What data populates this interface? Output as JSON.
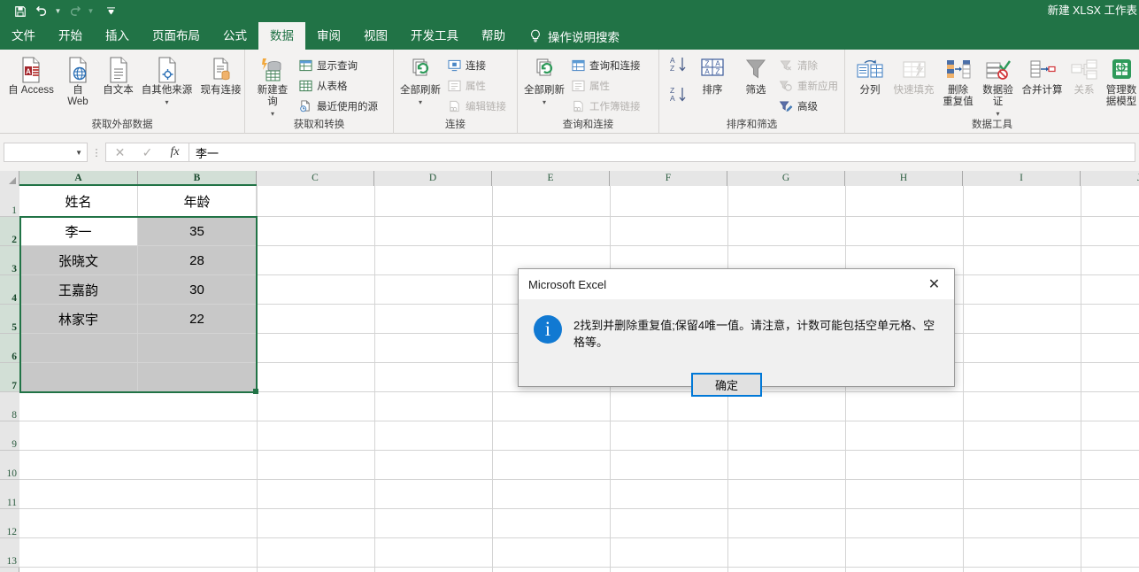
{
  "window": {
    "title": "新建 XLSX 工作表",
    "app": "Microsoft Excel"
  },
  "quick_access": {
    "save": "save-icon",
    "undo": "undo-icon",
    "redo": "redo-icon",
    "customize": "customize-qat-icon"
  },
  "tabs": [
    {
      "label": "文件",
      "active": false
    },
    {
      "label": "开始",
      "active": false
    },
    {
      "label": "插入",
      "active": false
    },
    {
      "label": "页面布局",
      "active": false
    },
    {
      "label": "公式",
      "active": false
    },
    {
      "label": "数据",
      "active": true
    },
    {
      "label": "审阅",
      "active": false
    },
    {
      "label": "视图",
      "active": false
    },
    {
      "label": "开发工具",
      "active": false
    },
    {
      "label": "帮助",
      "active": false
    }
  ],
  "tell_me": "操作说明搜索",
  "ribbon": {
    "groups": [
      {
        "name": "获取外部数据",
        "label": "获取外部数据",
        "buttons": [
          {
            "label": "自 Access",
            "icon": "access-db-icon",
            "disabled": false
          },
          {
            "label": "自\nWeb",
            "icon": "web-globe-icon",
            "disabled": false
          },
          {
            "label": "自文本",
            "icon": "text-file-icon",
            "disabled": false
          },
          {
            "label": "自其他来源",
            "icon": "other-sources-icon",
            "disabled": false,
            "dropdown": true
          },
          {
            "label": "现有连接",
            "icon": "existing-connection-icon",
            "disabled": false
          }
        ]
      },
      {
        "name": "获取和转换",
        "label": "获取和转换",
        "big": {
          "label": "新建查\n询",
          "icon": "new-query-icon",
          "dropdown": true
        },
        "small": [
          {
            "label": "显示查询",
            "icon": "show-queries-icon",
            "disabled": false
          },
          {
            "label": "从表格",
            "icon": "from-table-icon",
            "disabled": false
          },
          {
            "label": "最近使用的源",
            "icon": "recent-sources-icon",
            "disabled": false
          }
        ]
      },
      {
        "name": "连接",
        "label": "连接",
        "big": {
          "label": "全部刷新",
          "icon": "refresh-all-icon",
          "dropdown": true
        },
        "small": [
          {
            "label": "连接",
            "icon": "connections-icon",
            "disabled": false
          },
          {
            "label": "属性",
            "icon": "properties-icon",
            "disabled": true
          },
          {
            "label": "编辑链接",
            "icon": "edit-links-icon",
            "disabled": true
          }
        ]
      },
      {
        "name": "查询和连接",
        "label": "查询和连接",
        "big": {
          "label": "全部刷新",
          "icon": "refresh-all-icon",
          "dropdown": true
        },
        "small": [
          {
            "label": "查询和连接",
            "icon": "queries-connections-icon",
            "disabled": false
          },
          {
            "label": "属性",
            "icon": "properties-icon",
            "disabled": true
          },
          {
            "label": "工作簿链接",
            "icon": "workbook-links-icon",
            "disabled": true
          }
        ]
      },
      {
        "name": "排序和筛选",
        "label": "排序和筛选",
        "buttons": [
          {
            "label": "",
            "icon": "sort-az-icon",
            "disabled": false
          },
          {
            "label": "",
            "icon": "sort-za-icon",
            "disabled": false
          },
          {
            "label": "排序",
            "icon": "sort-dialog-icon",
            "disabled": false
          },
          {
            "label": "筛选",
            "icon": "filter-funnel-icon",
            "disabled": false
          }
        ],
        "small": [
          {
            "label": "清除",
            "icon": "clear-filter-icon",
            "disabled": true
          },
          {
            "label": "重新应用",
            "icon": "reapply-filter-icon",
            "disabled": true
          },
          {
            "label": "高级",
            "icon": "advanced-filter-icon",
            "disabled": false
          }
        ]
      },
      {
        "name": "数据工具",
        "label": "数据工具",
        "buttons": [
          {
            "label": "分列",
            "icon": "text-to-columns-icon",
            "disabled": false
          },
          {
            "label": "快速填充",
            "icon": "flash-fill-icon",
            "disabled": true
          },
          {
            "label": "删除\n重复值",
            "icon": "remove-duplicates-icon",
            "disabled": false
          },
          {
            "label": "数据验\n证",
            "icon": "data-validation-icon",
            "disabled": false,
            "dropdown": true
          },
          {
            "label": "合并计算",
            "icon": "consolidate-icon",
            "disabled": false
          },
          {
            "label": "关系",
            "icon": "relationships-icon",
            "disabled": true
          },
          {
            "label": "管理数\n据模型",
            "icon": "manage-data-model-icon",
            "disabled": false
          }
        ]
      }
    ]
  },
  "formula_bar": {
    "name_box": "",
    "cancel": "cancel-icon",
    "enter": "enter-icon",
    "insert_function": "fx",
    "value": "李一"
  },
  "sheet": {
    "columns": [
      "A",
      "B",
      "C",
      "D",
      "E",
      "F",
      "G",
      "H",
      "I",
      "J"
    ],
    "rows": [
      "1",
      "2",
      "3",
      "4",
      "5",
      "6",
      "7",
      "8",
      "9",
      "10",
      "11",
      "12",
      "13"
    ],
    "headers": [
      "姓名",
      "年龄"
    ],
    "data": [
      {
        "name": "李一",
        "age": "35"
      },
      {
        "name": "张晓文",
        "age": "28"
      },
      {
        "name": "王嘉韵",
        "age": "30"
      },
      {
        "name": "林家宇",
        "age": "22"
      }
    ],
    "selection_range": "A2:B7",
    "active_cell": "A2"
  },
  "dialog": {
    "title": "Microsoft Excel",
    "close": "close-icon",
    "icon": "info-icon",
    "message": "2找到并删除重复值;保留4唯一值。请注意，计数可能包括空单元格、空格等。",
    "ok_label": "确定"
  },
  "colors": {
    "excel_green": "#217346",
    "ribbon_bg": "#f3f2f1",
    "selection_green": "#217346",
    "selection_shade": "#c8c8c8",
    "dialog_blue": "#0078d7",
    "info_blue": "#1179d2"
  }
}
